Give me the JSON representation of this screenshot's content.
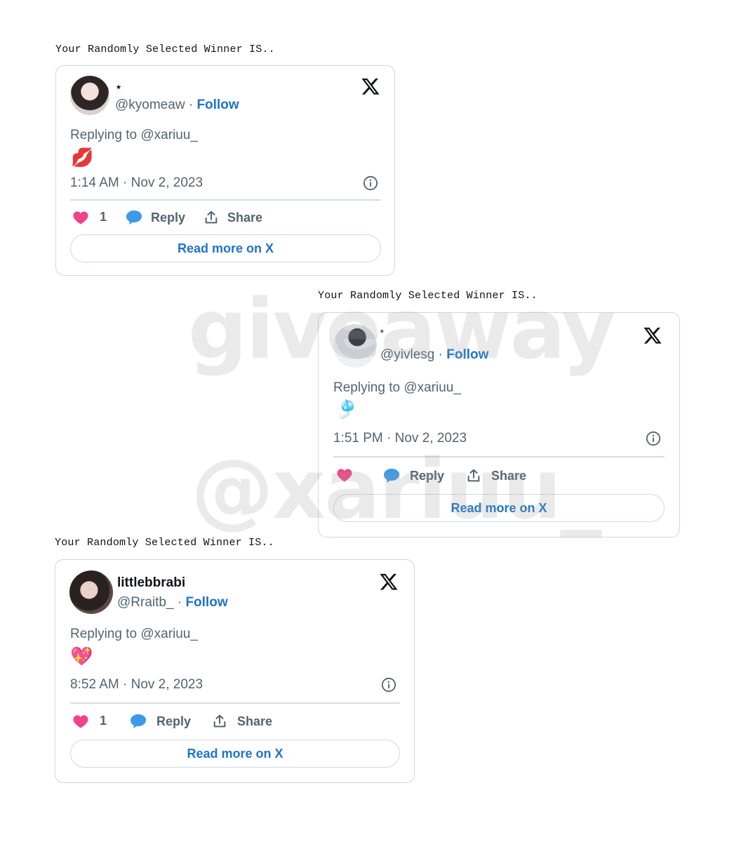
{
  "colors": {
    "accent": "#1d74c9",
    "muted_text": "#536471",
    "like_heart": "#f0448a",
    "reply_bubble": "#3d9ae8",
    "card_border": "#cfd9de"
  },
  "watermark": {
    "line1": "giveaway",
    "line2": "@xariuu_"
  },
  "cards": [
    {
      "heading": "Your Randomly Selected Winner IS..",
      "display_name": "⋆",
      "handle": "@kyomeaw",
      "separator": "·",
      "follow_label": "Follow",
      "replying_to": "Replying to @xariuu_",
      "emoji": "💋",
      "timestamp": "1:14 AM · Nov 2, 2023",
      "like_count": "1",
      "reply_label": "Reply",
      "share_label": "Share",
      "read_more_label": "Read more on X",
      "icons": [
        "x-logo-icon",
        "info-icon",
        "heart-icon",
        "reply-bubble-icon",
        "share-icon"
      ]
    },
    {
      "heading": "Your Randomly Selected Winner IS..",
      "display_name": "˚",
      "handle": "@yivlesg",
      "separator": "·",
      "follow_label": "Follow",
      "replying_to": "Replying to @xariuu_",
      "emoji": "🎐",
      "timestamp": "1:51 PM · Nov 2, 2023",
      "like_count": "",
      "reply_label": "Reply",
      "share_label": "Share",
      "read_more_label": "Read more on X",
      "icons": [
        "x-logo-icon",
        "info-icon",
        "heart-icon",
        "reply-bubble-icon",
        "share-icon"
      ]
    },
    {
      "heading": "Your Randomly Selected Winner IS..",
      "display_name": "littlebbrabi",
      "handle": "@Rraitb_",
      "separator": "·",
      "follow_label": "Follow",
      "replying_to": "Replying to @xariuu_",
      "emoji": "💖",
      "timestamp": "8:52 AM · Nov 2, 2023",
      "like_count": "1",
      "reply_label": "Reply",
      "share_label": "Share",
      "read_more_label": "Read more on X",
      "icons": [
        "x-logo-icon",
        "info-icon",
        "heart-icon",
        "reply-bubble-icon",
        "share-icon"
      ]
    }
  ]
}
